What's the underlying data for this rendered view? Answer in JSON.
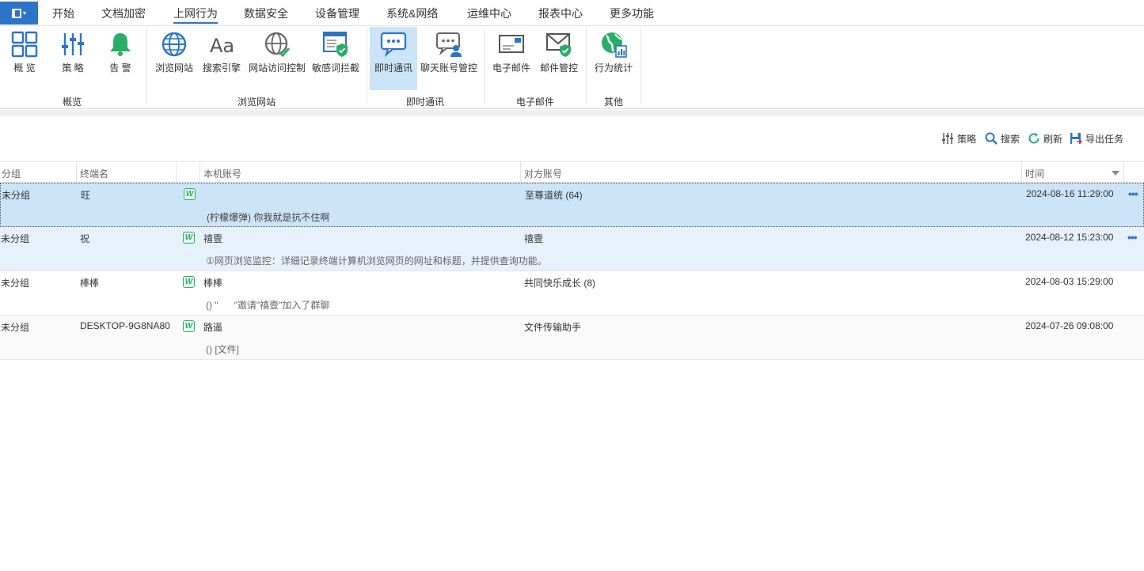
{
  "menu": {
    "items": [
      "开始",
      "文档加密",
      "上网行为",
      "数据安全",
      "设备管理",
      "系统&网络",
      "运维中心",
      "报表中心",
      "更多功能"
    ],
    "active_index": 2
  },
  "ribbon": {
    "groups": [
      {
        "label": "概览",
        "buttons": [
          {
            "label": "概 览",
            "icon": "overview-grid-icon"
          },
          {
            "label": "策 略",
            "icon": "policy-sliders-icon"
          },
          {
            "label": "告 警",
            "icon": "alarm-bell-icon"
          }
        ]
      },
      {
        "label": "浏览网站",
        "buttons": [
          {
            "label": "浏览网站",
            "icon": "globe-icon"
          },
          {
            "label": "搜索引擎",
            "icon": "search-engine-aa-icon"
          },
          {
            "label": "网站访问控制",
            "icon": "globe-check-icon"
          },
          {
            "label": "敏感词拦截",
            "icon": "sensitive-word-shield-icon"
          }
        ]
      },
      {
        "label": "即时通讯",
        "buttons": [
          {
            "label": "即时通讯",
            "icon": "chat-bubble-icon"
          },
          {
            "label": "聊天账号管控",
            "icon": "chat-account-icon"
          }
        ]
      },
      {
        "label": "电子邮件",
        "buttons": [
          {
            "label": "电子邮件",
            "icon": "email-icon"
          },
          {
            "label": "邮件管控",
            "icon": "email-shield-icon"
          }
        ]
      },
      {
        "label": "其他",
        "buttons": [
          {
            "label": "行为统计",
            "icon": "behavior-stats-icon"
          }
        ]
      }
    ],
    "active_button": "即时通讯"
  },
  "toolbar": {
    "policy": "策略",
    "search": "搜索",
    "refresh": "刷新",
    "export": "导出任务"
  },
  "table": {
    "columns": [
      "分组",
      "终端名",
      "本机账号",
      "对方账号",
      "时间"
    ],
    "rows": [
      {
        "group": "未分组",
        "terminal": "旺",
        "local": "",
        "peer": "至尊道统 (64)",
        "time": "2024-08-16 11:29:00",
        "message": "(柠檬爆弹) 你我就是抗不住啊",
        "state": "selected",
        "more": "•••"
      },
      {
        "group": "未分组",
        "terminal": "祝",
        "local": "禧壹",
        "peer": "禧壹",
        "time": "2024-08-12 15:23:00",
        "message": "①网页浏览监控：详细记录终端计算机浏览网页的网址和标题，并提供查询功能。",
        "state": "hover",
        "more": "•••"
      },
      {
        "group": "未分组",
        "terminal": "棒棒",
        "local": "棒棒",
        "peer": "共同快乐成长 (8)",
        "time": "2024-08-03 15:29:00",
        "message": "() \"      \"邀请\"禧壹\"加入了群聊",
        "state": "normal",
        "more": ""
      },
      {
        "group": "未分组",
        "terminal": "DESKTOP-9G8NA80",
        "local": "路遥",
        "peer": "文件传输助手",
        "time": "2024-07-26 09:08:00",
        "message": "() [文件]",
        "state": "alt",
        "more": ""
      }
    ]
  },
  "colors": {
    "accent": "#2b74c8",
    "selected_row": "#cce4f7",
    "wechat_green": "#2aae67"
  }
}
